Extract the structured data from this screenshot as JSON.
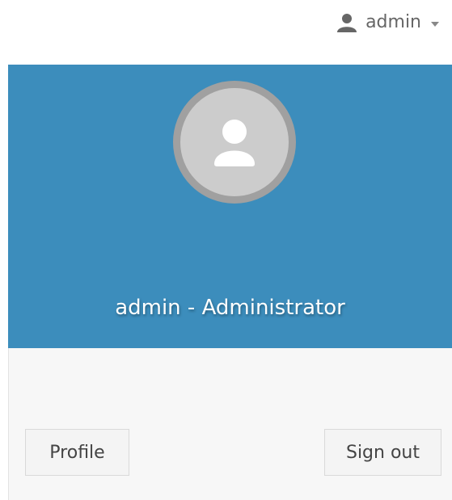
{
  "navbar": {
    "user_toggle": {
      "username": "admin",
      "icon": "user-icon",
      "caret_icon": "caret-down-icon"
    }
  },
  "user_menu": {
    "header": {
      "background_color": "#3c8dbc",
      "avatar_icon": "user-avatar-icon",
      "title": "admin - Administrator"
    },
    "footer": {
      "profile_label": "Profile",
      "signout_label": "Sign out"
    }
  }
}
